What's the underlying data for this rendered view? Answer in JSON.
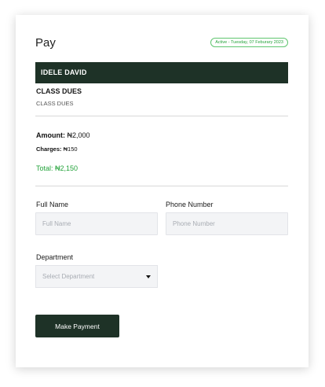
{
  "header": {
    "title": "Pay",
    "status_badge": "Active - Tuesday, 07 Feburary 2023"
  },
  "payer": {
    "name": "IDELE DAVID"
  },
  "item": {
    "title": "CLASS DUES",
    "subtitle": "CLASS DUES"
  },
  "summary": {
    "amount_label": "Amount:",
    "amount_value": "₦2,000",
    "charges_label": "Charges:",
    "charges_value": "₦150",
    "total_label": "Total:",
    "total_value": "₦2,150"
  },
  "form": {
    "full_name_label": "Full Name",
    "full_name_placeholder": "Full Name",
    "full_name_value": "",
    "phone_label": "Phone Number",
    "phone_placeholder": "Phone Number",
    "phone_value": "",
    "department_label": "Department",
    "department_selected": "Select Department",
    "submit_label": "Make Payment"
  },
  "colors": {
    "brand_dark_green": "#1e3227",
    "success_green": "#23a33a",
    "input_bg": "#f3f4f6"
  },
  "icons": {
    "select_caret": "caret-down-icon"
  }
}
